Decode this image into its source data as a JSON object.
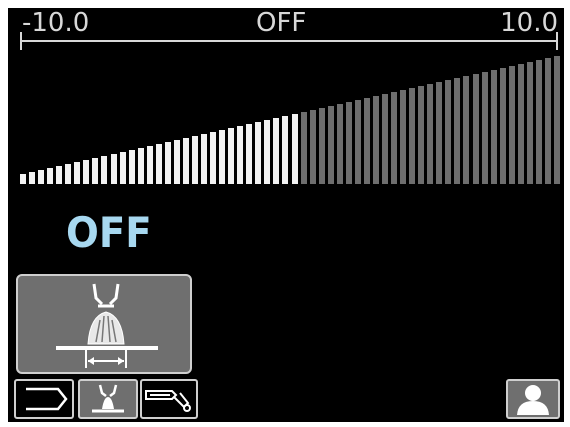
{
  "scale": {
    "min_label": "-10.0",
    "mid_label": "OFF",
    "max_label": "10.0"
  },
  "value": {
    "text": "OFF"
  },
  "bars": {
    "count": 60,
    "highlighted": 31
  },
  "colors": {
    "background": "#000000",
    "scale": "#d8d8d8",
    "bar_active": "#f2f2f2",
    "bar_inactive": "#6e6e6e",
    "value_text": "#a7d8f0",
    "button_bg": "#6f6f6f",
    "button_border": "#cfcfcf"
  },
  "icons": {
    "process_button": "weld-bead-width-icon",
    "tab_back": "back-arrow-tab-icon",
    "tab_process": "welding-process-icon",
    "tab_torch": "torch-icon",
    "user": "user-profile-icon"
  }
}
